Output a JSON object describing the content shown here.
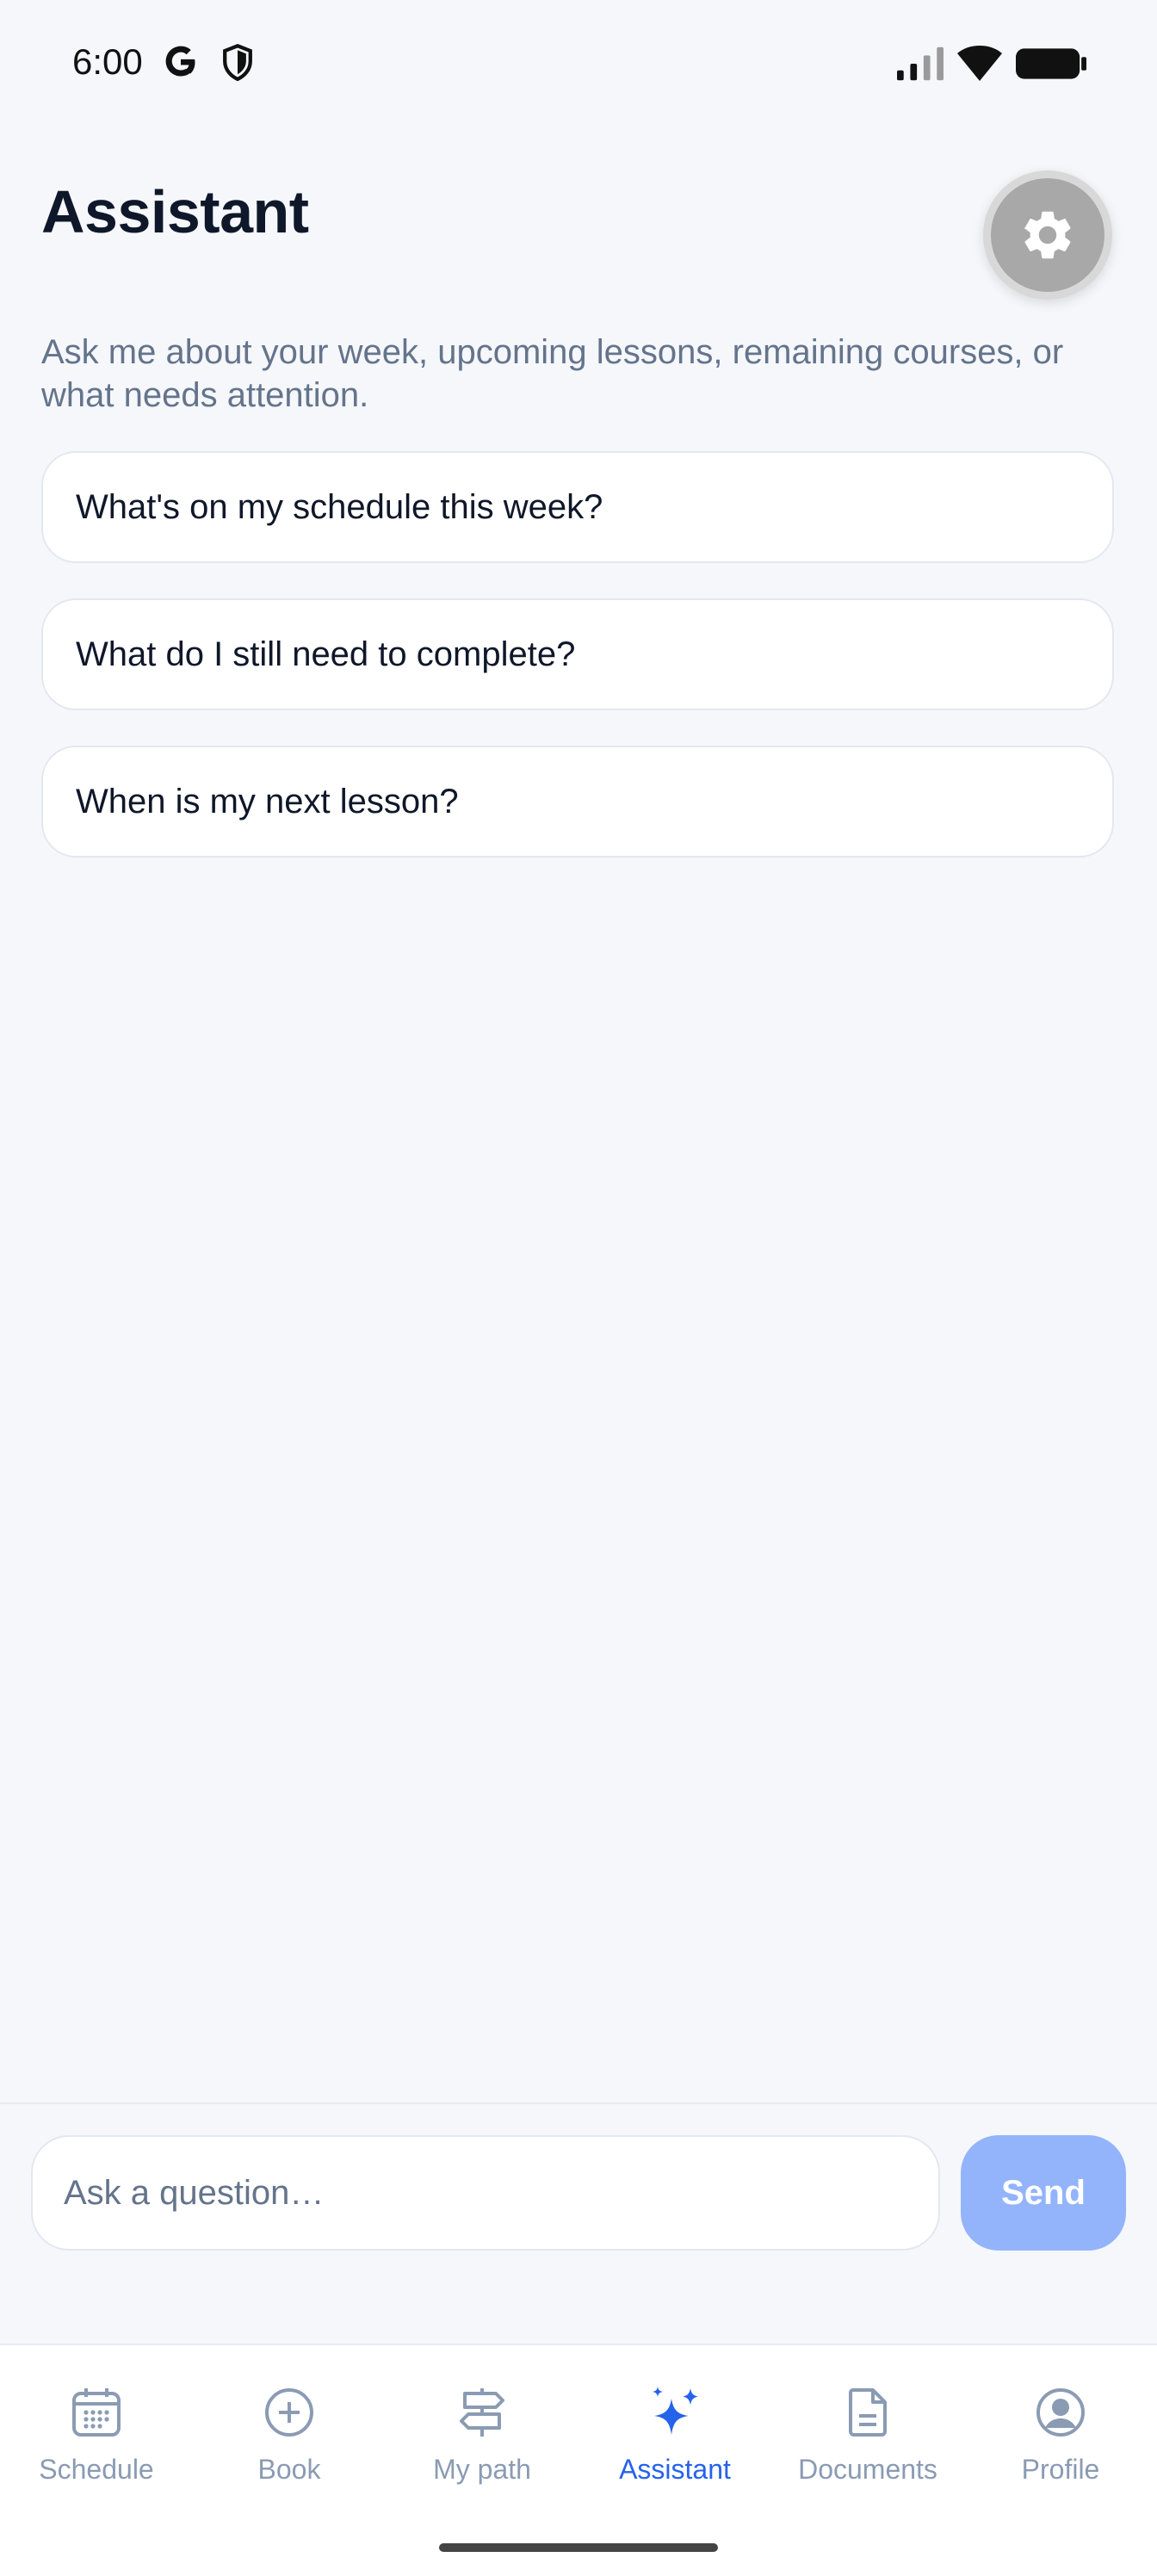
{
  "status_bar": {
    "time": "6:00",
    "icons": [
      "google-g-icon",
      "shield-icon",
      "signal-icon",
      "wifi-icon",
      "battery-icon"
    ]
  },
  "header": {
    "title": "Assistant",
    "settings_icon": "gear-icon"
  },
  "intro": "Ask me about your week, upcoming lessons, remaining courses, or what needs attention.",
  "suggestions": [
    "What's on my schedule this week?",
    "What do I still need to complete?",
    "When is my next lesson?"
  ],
  "composer": {
    "placeholder": "Ask a question…",
    "send_label": "Send"
  },
  "tabs": [
    {
      "label": "Schedule",
      "icon": "calendar-icon"
    },
    {
      "label": "Book",
      "icon": "plus-circle-icon"
    },
    {
      "label": "My path",
      "icon": "signpost-icon"
    },
    {
      "label": "Assistant",
      "icon": "sparkles-icon",
      "active": true
    },
    {
      "label": "Documents",
      "icon": "document-icon"
    },
    {
      "label": "Profile",
      "icon": "user-circle-icon"
    }
  ],
  "colors": {
    "accent": "#2563eb",
    "send_disabled": "#93b4fb",
    "inactive_tab": "#8a9bb3",
    "background": "#f5f7fb"
  }
}
